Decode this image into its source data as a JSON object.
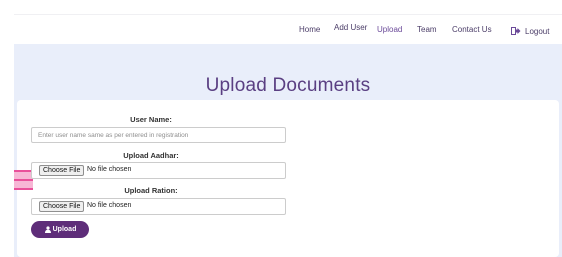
{
  "nav": {
    "home": "Home",
    "add_user": "Add User",
    "upload": "Upload",
    "team": "Team",
    "contact": "Contact Us",
    "logout": "Logout"
  },
  "icons": {
    "logout": "logout-icon",
    "upload": "upload-icon"
  },
  "colors": {
    "accent": "#5e2d79",
    "title": "#5a3f82",
    "hero_bg": "#e9eefa"
  },
  "page": {
    "title": "Upload Documents"
  },
  "form": {
    "user_name_label": "User Name:",
    "user_name_placeholder": "Enter user name same as per entered in registration",
    "user_name_value": "",
    "aadhar_label": "Upload Aadhar:",
    "aadhar_button": "Choose File",
    "aadhar_status": "No file chosen",
    "ration_label": "Upload Ration:",
    "ration_button": "Choose File",
    "ration_status": "No file chosen",
    "submit_label": "Upload"
  }
}
